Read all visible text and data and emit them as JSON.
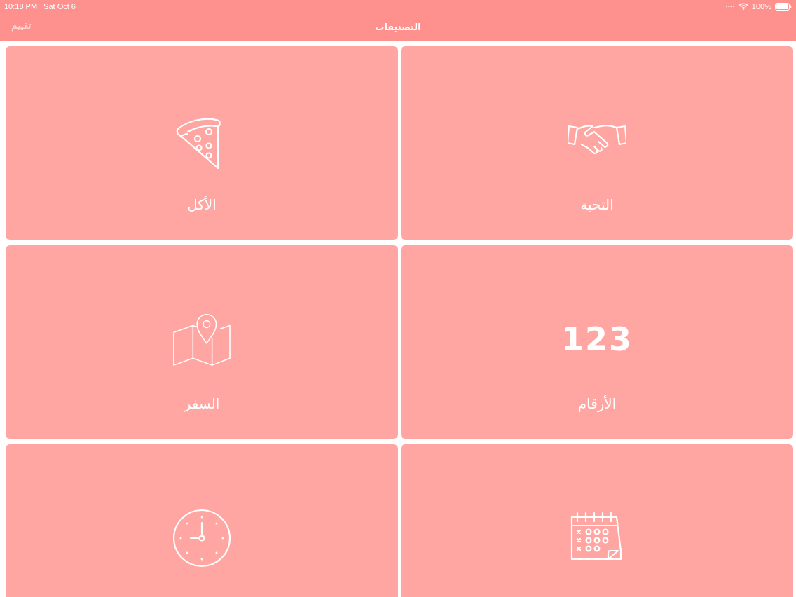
{
  "status_bar": {
    "time": "10:18 PM",
    "date": "Sat Oct 6",
    "battery": "100%"
  },
  "nav_bar": {
    "title": "التصنيفات",
    "left_button": "تقييم"
  },
  "categories": [
    {
      "kind": "handshake",
      "label": "التحية"
    },
    {
      "kind": "pizza",
      "label": "الأكل"
    },
    {
      "kind": "digits",
      "icon_text": "123",
      "label": "الأرقام"
    },
    {
      "kind": "map",
      "label": "السفر"
    },
    {
      "kind": "calendar"
    },
    {
      "kind": "clock"
    }
  ]
}
